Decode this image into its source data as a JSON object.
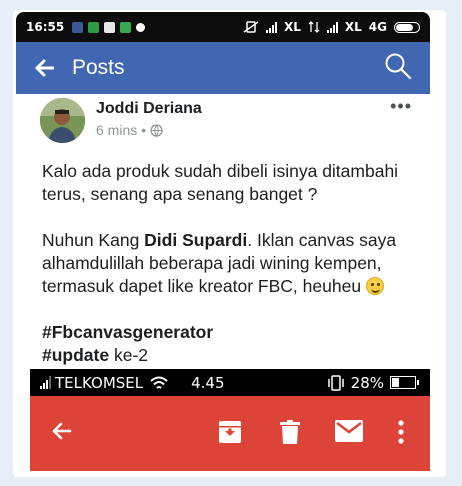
{
  "top_status": {
    "time": "16:55",
    "carrier_1": "XL",
    "carrier_2": "XL",
    "network": "4G"
  },
  "app_bar": {
    "title": "Posts",
    "back_icon": "arrow-left-icon",
    "search_icon": "search-icon",
    "color": "#4267b2"
  },
  "post": {
    "author": "Joddi Deriana",
    "time": "6 mins",
    "separator": "•",
    "privacy_icon": "globe-icon",
    "more_label": "•••",
    "para1": "Kalo ada produk sudah dibeli isinya ditambahi terus, senang apa senang banget ?",
    "para2_a": "Nuhun Kang ",
    "para2_mention": "Didi Supardi",
    "para2_b": ". Iklan canvas saya alhamdulillah beberapa jadi wining kempen, termasuk dapet like kreator FBC, heuheu",
    "hashtag1": "#Fbcanvasgenerator",
    "hashtag2": "#update",
    "hashtag2_suffix": " ke-2"
  },
  "bottom_status": {
    "carrier": "TELKOMSEL",
    "time": "4.45",
    "battery": "28%"
  },
  "gmail_bar": {
    "color": "#db4437",
    "icons": [
      "back-arrow-icon",
      "archive-icon",
      "trash-icon",
      "mail-icon",
      "more-vert-icon"
    ]
  }
}
